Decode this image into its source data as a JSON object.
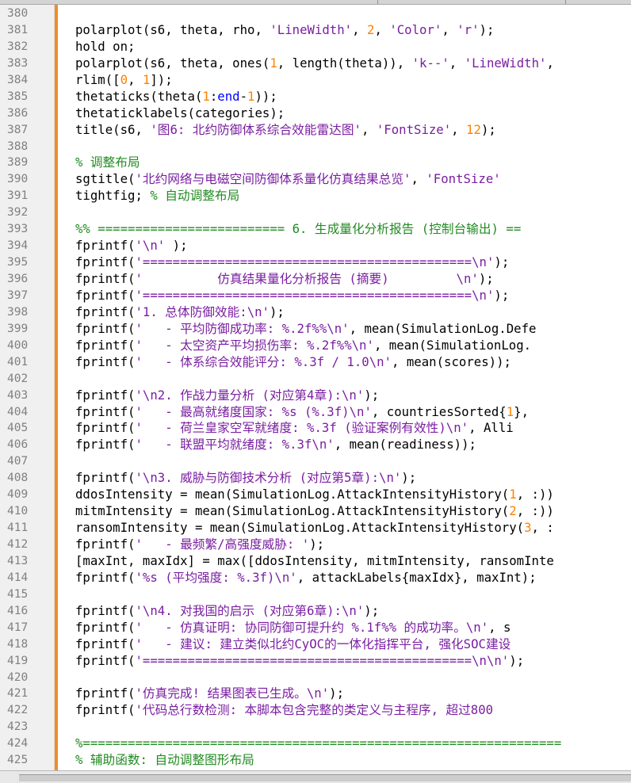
{
  "editor": {
    "language": "MATLAB",
    "colors": {
      "string": "#7a1ea1",
      "number": "#ff8000",
      "comment": "#228b22",
      "keyword": "#0000ff",
      "default": "#000000",
      "line_number": "#808080",
      "fold_marker": "#f28c28"
    },
    "lines": [
      {
        "n": "380",
        "tokens": []
      },
      {
        "n": "381",
        "tokens": [
          {
            "t": "polarplot(s6, theta, rho, ",
            "k": "def"
          },
          {
            "t": "'LineWidth'",
            "k": "str"
          },
          {
            "t": ", ",
            "k": "def"
          },
          {
            "t": "2",
            "k": "num"
          },
          {
            "t": ", ",
            "k": "def"
          },
          {
            "t": "'Color'",
            "k": "str"
          },
          {
            "t": ", ",
            "k": "def"
          },
          {
            "t": "'r'",
            "k": "str"
          },
          {
            "t": ");",
            "k": "def"
          }
        ]
      },
      {
        "n": "382",
        "tokens": [
          {
            "t": "hold on;",
            "k": "def"
          }
        ]
      },
      {
        "n": "383",
        "tokens": [
          {
            "t": "polarplot(s6, theta, ones(",
            "k": "def"
          },
          {
            "t": "1",
            "k": "num"
          },
          {
            "t": ", length(theta)), ",
            "k": "def"
          },
          {
            "t": "'k--'",
            "k": "str"
          },
          {
            "t": ", ",
            "k": "def"
          },
          {
            "t": "'LineWidth'",
            "k": "str"
          },
          {
            "t": ", ",
            "k": "def"
          }
        ]
      },
      {
        "n": "384",
        "tokens": [
          {
            "t": "rlim([",
            "k": "def"
          },
          {
            "t": "0",
            "k": "num"
          },
          {
            "t": ", ",
            "k": "def"
          },
          {
            "t": "1",
            "k": "num"
          },
          {
            "t": "]);",
            "k": "def"
          }
        ]
      },
      {
        "n": "385",
        "tokens": [
          {
            "t": "thetaticks(theta(",
            "k": "def"
          },
          {
            "t": "1",
            "k": "num"
          },
          {
            "t": ":",
            "k": "def"
          },
          {
            "t": "end",
            "k": "kw"
          },
          {
            "t": "-",
            "k": "def"
          },
          {
            "t": "1",
            "k": "num"
          },
          {
            "t": "));",
            "k": "def"
          }
        ]
      },
      {
        "n": "386",
        "tokens": [
          {
            "t": "thetaticklabels(categories);",
            "k": "def"
          }
        ]
      },
      {
        "n": "387",
        "tokens": [
          {
            "t": "title(s6, ",
            "k": "def"
          },
          {
            "t": "'图6: 北约防御体系综合效能雷达图'",
            "k": "str"
          },
          {
            "t": ", ",
            "k": "def"
          },
          {
            "t": "'FontSize'",
            "k": "str"
          },
          {
            "t": ", ",
            "k": "def"
          },
          {
            "t": "12",
            "k": "num"
          },
          {
            "t": ");",
            "k": "def"
          }
        ]
      },
      {
        "n": "388",
        "tokens": []
      },
      {
        "n": "389",
        "tokens": [
          {
            "t": "% 调整布局",
            "k": "com"
          }
        ]
      },
      {
        "n": "390",
        "tokens": [
          {
            "t": "sgtitle(",
            "k": "def"
          },
          {
            "t": "'北约网络与电磁空间防御体系量化仿真结果总览'",
            "k": "str"
          },
          {
            "t": ", ",
            "k": "def"
          },
          {
            "t": "'FontSize'",
            "k": "str"
          }
        ]
      },
      {
        "n": "391",
        "tokens": [
          {
            "t": "tightfig; ",
            "k": "def"
          },
          {
            "t": "% 自动调整布局",
            "k": "com"
          }
        ]
      },
      {
        "n": "392",
        "tokens": []
      },
      {
        "n": "393",
        "tokens": [
          {
            "t": "%% ========================= 6. 生成量化分析报告 (控制台输出) ==",
            "k": "com"
          }
        ]
      },
      {
        "n": "394",
        "tokens": [
          {
            "t": "fprintf(",
            "k": "def"
          },
          {
            "t": "'\\n'",
            "k": "str"
          },
          {
            "t": " );",
            "k": "def"
          }
        ]
      },
      {
        "n": "395",
        "tokens": [
          {
            "t": "fprintf(",
            "k": "def"
          },
          {
            "t": "'============================================\\n'",
            "k": "str"
          },
          {
            "t": ");",
            "k": "def"
          }
        ]
      },
      {
        "n": "396",
        "tokens": [
          {
            "t": "fprintf(",
            "k": "def"
          },
          {
            "t": "'          仿真结果量化分析报告 (摘要)         \\n'",
            "k": "str"
          },
          {
            "t": ");",
            "k": "def"
          }
        ]
      },
      {
        "n": "397",
        "tokens": [
          {
            "t": "fprintf(",
            "k": "def"
          },
          {
            "t": "'============================================\\n'",
            "k": "str"
          },
          {
            "t": ");",
            "k": "def"
          }
        ]
      },
      {
        "n": "398",
        "tokens": [
          {
            "t": "fprintf(",
            "k": "def"
          },
          {
            "t": "'1. 总体防御效能:\\n'",
            "k": "str"
          },
          {
            "t": ");",
            "k": "def"
          }
        ]
      },
      {
        "n": "399",
        "tokens": [
          {
            "t": "fprintf(",
            "k": "def"
          },
          {
            "t": "'   - 平均防御成功率: %.2f%%\\n'",
            "k": "str"
          },
          {
            "t": ", mean(SimulationLog.Defe",
            "k": "def"
          }
        ]
      },
      {
        "n": "400",
        "tokens": [
          {
            "t": "fprintf(",
            "k": "def"
          },
          {
            "t": "'   - 太空资产平均损伤率: %.2f%%\\n'",
            "k": "str"
          },
          {
            "t": ", mean(SimulationLog.",
            "k": "def"
          }
        ]
      },
      {
        "n": "401",
        "tokens": [
          {
            "t": "fprintf(",
            "k": "def"
          },
          {
            "t": "'   - 体系综合效能评分: %.3f / 1.0\\n'",
            "k": "str"
          },
          {
            "t": ", mean(scores));",
            "k": "def"
          }
        ]
      },
      {
        "n": "402",
        "tokens": []
      },
      {
        "n": "403",
        "tokens": [
          {
            "t": "fprintf(",
            "k": "def"
          },
          {
            "t": "'\\n2. 作战力量分析 (对应第4章):\\n'",
            "k": "str"
          },
          {
            "t": ");",
            "k": "def"
          }
        ]
      },
      {
        "n": "404",
        "tokens": [
          {
            "t": "fprintf(",
            "k": "def"
          },
          {
            "t": "'   - 最高就绪度国家: %s (%.3f)\\n'",
            "k": "str"
          },
          {
            "t": ", countriesSorted{",
            "k": "def"
          },
          {
            "t": "1",
            "k": "num"
          },
          {
            "t": "},",
            "k": "def"
          }
        ]
      },
      {
        "n": "405",
        "tokens": [
          {
            "t": "fprintf(",
            "k": "def"
          },
          {
            "t": "'   - 荷兰皇家空军就绪度: %.3f (验证案例有效性)\\n'",
            "k": "str"
          },
          {
            "t": ", Alli",
            "k": "def"
          }
        ]
      },
      {
        "n": "406",
        "tokens": [
          {
            "t": "fprintf(",
            "k": "def"
          },
          {
            "t": "'   - 联盟平均就绪度: %.3f\\n'",
            "k": "str"
          },
          {
            "t": ", mean(readiness));",
            "k": "def"
          }
        ]
      },
      {
        "n": "407",
        "tokens": []
      },
      {
        "n": "408",
        "tokens": [
          {
            "t": "fprintf(",
            "k": "def"
          },
          {
            "t": "'\\n3. 威胁与防御技术分析 (对应第5章):\\n'",
            "k": "str"
          },
          {
            "t": ");",
            "k": "def"
          }
        ]
      },
      {
        "n": "409",
        "tokens": [
          {
            "t": "ddosIntensity = mean(SimulationLog.AttackIntensityHistory(",
            "k": "def"
          },
          {
            "t": "1",
            "k": "num"
          },
          {
            "t": ", :))",
            "k": "def"
          }
        ]
      },
      {
        "n": "410",
        "tokens": [
          {
            "t": "mitmIntensity = mean(SimulationLog.AttackIntensityHistory(",
            "k": "def"
          },
          {
            "t": "2",
            "k": "num"
          },
          {
            "t": ", :))",
            "k": "def"
          }
        ]
      },
      {
        "n": "411",
        "tokens": [
          {
            "t": "ransomIntensity = mean(SimulationLog.AttackIntensityHistory(",
            "k": "def"
          },
          {
            "t": "3",
            "k": "num"
          },
          {
            "t": ", :",
            "k": "def"
          }
        ]
      },
      {
        "n": "412",
        "tokens": [
          {
            "t": "fprintf(",
            "k": "def"
          },
          {
            "t": "'   - 最频繁/高强度威胁: '",
            "k": "str"
          },
          {
            "t": ");",
            "k": "def"
          }
        ]
      },
      {
        "n": "413",
        "tokens": [
          {
            "t": "[maxInt, maxIdx] = max([ddosIntensity, mitmIntensity, ransomInte",
            "k": "def"
          }
        ]
      },
      {
        "n": "414",
        "tokens": [
          {
            "t": "fprintf(",
            "k": "def"
          },
          {
            "t": "'%s (平均强度: %.3f)\\n'",
            "k": "str"
          },
          {
            "t": ", attackLabels{maxIdx}, maxInt);",
            "k": "def"
          }
        ]
      },
      {
        "n": "415",
        "tokens": []
      },
      {
        "n": "416",
        "tokens": [
          {
            "t": "fprintf(",
            "k": "def"
          },
          {
            "t": "'\\n4. 对我国的启示 (对应第6章):\\n'",
            "k": "str"
          },
          {
            "t": ");",
            "k": "def"
          }
        ]
      },
      {
        "n": "417",
        "tokens": [
          {
            "t": "fprintf(",
            "k": "def"
          },
          {
            "t": "'   - 仿真证明: 协同防御可提升约 %.1f%% 的成功率。\\n'",
            "k": "str"
          },
          {
            "t": ", s",
            "k": "def"
          }
        ]
      },
      {
        "n": "418",
        "tokens": [
          {
            "t": "fprintf(",
            "k": "def"
          },
          {
            "t": "'   - 建议: 建立类似北约CyOC的一体化指挥平台, 强化SOC建设",
            "k": "str"
          }
        ]
      },
      {
        "n": "419",
        "tokens": [
          {
            "t": "fprintf(",
            "k": "def"
          },
          {
            "t": "'============================================\\n\\n'",
            "k": "str"
          },
          {
            "t": ");",
            "k": "def"
          }
        ]
      },
      {
        "n": "420",
        "tokens": []
      },
      {
        "n": "421",
        "tokens": [
          {
            "t": "fprintf(",
            "k": "def"
          },
          {
            "t": "'仿真完成! 结果图表已生成。\\n'",
            "k": "str"
          },
          {
            "t": ");",
            "k": "def"
          }
        ]
      },
      {
        "n": "422",
        "tokens": [
          {
            "t": "fprintf(",
            "k": "def"
          },
          {
            "t": "'代码总行数检测: 本脚本包含完整的类定义与主程序, 超过800",
            "k": "str"
          }
        ]
      },
      {
        "n": "423",
        "tokens": []
      },
      {
        "n": "424",
        "tokens": [
          {
            "t": "%================================================================",
            "k": "com"
          }
        ]
      },
      {
        "n": "425",
        "tokens": [
          {
            "t": "% 辅助函数: 自动调整图形布局",
            "k": "com"
          }
        ]
      }
    ]
  }
}
